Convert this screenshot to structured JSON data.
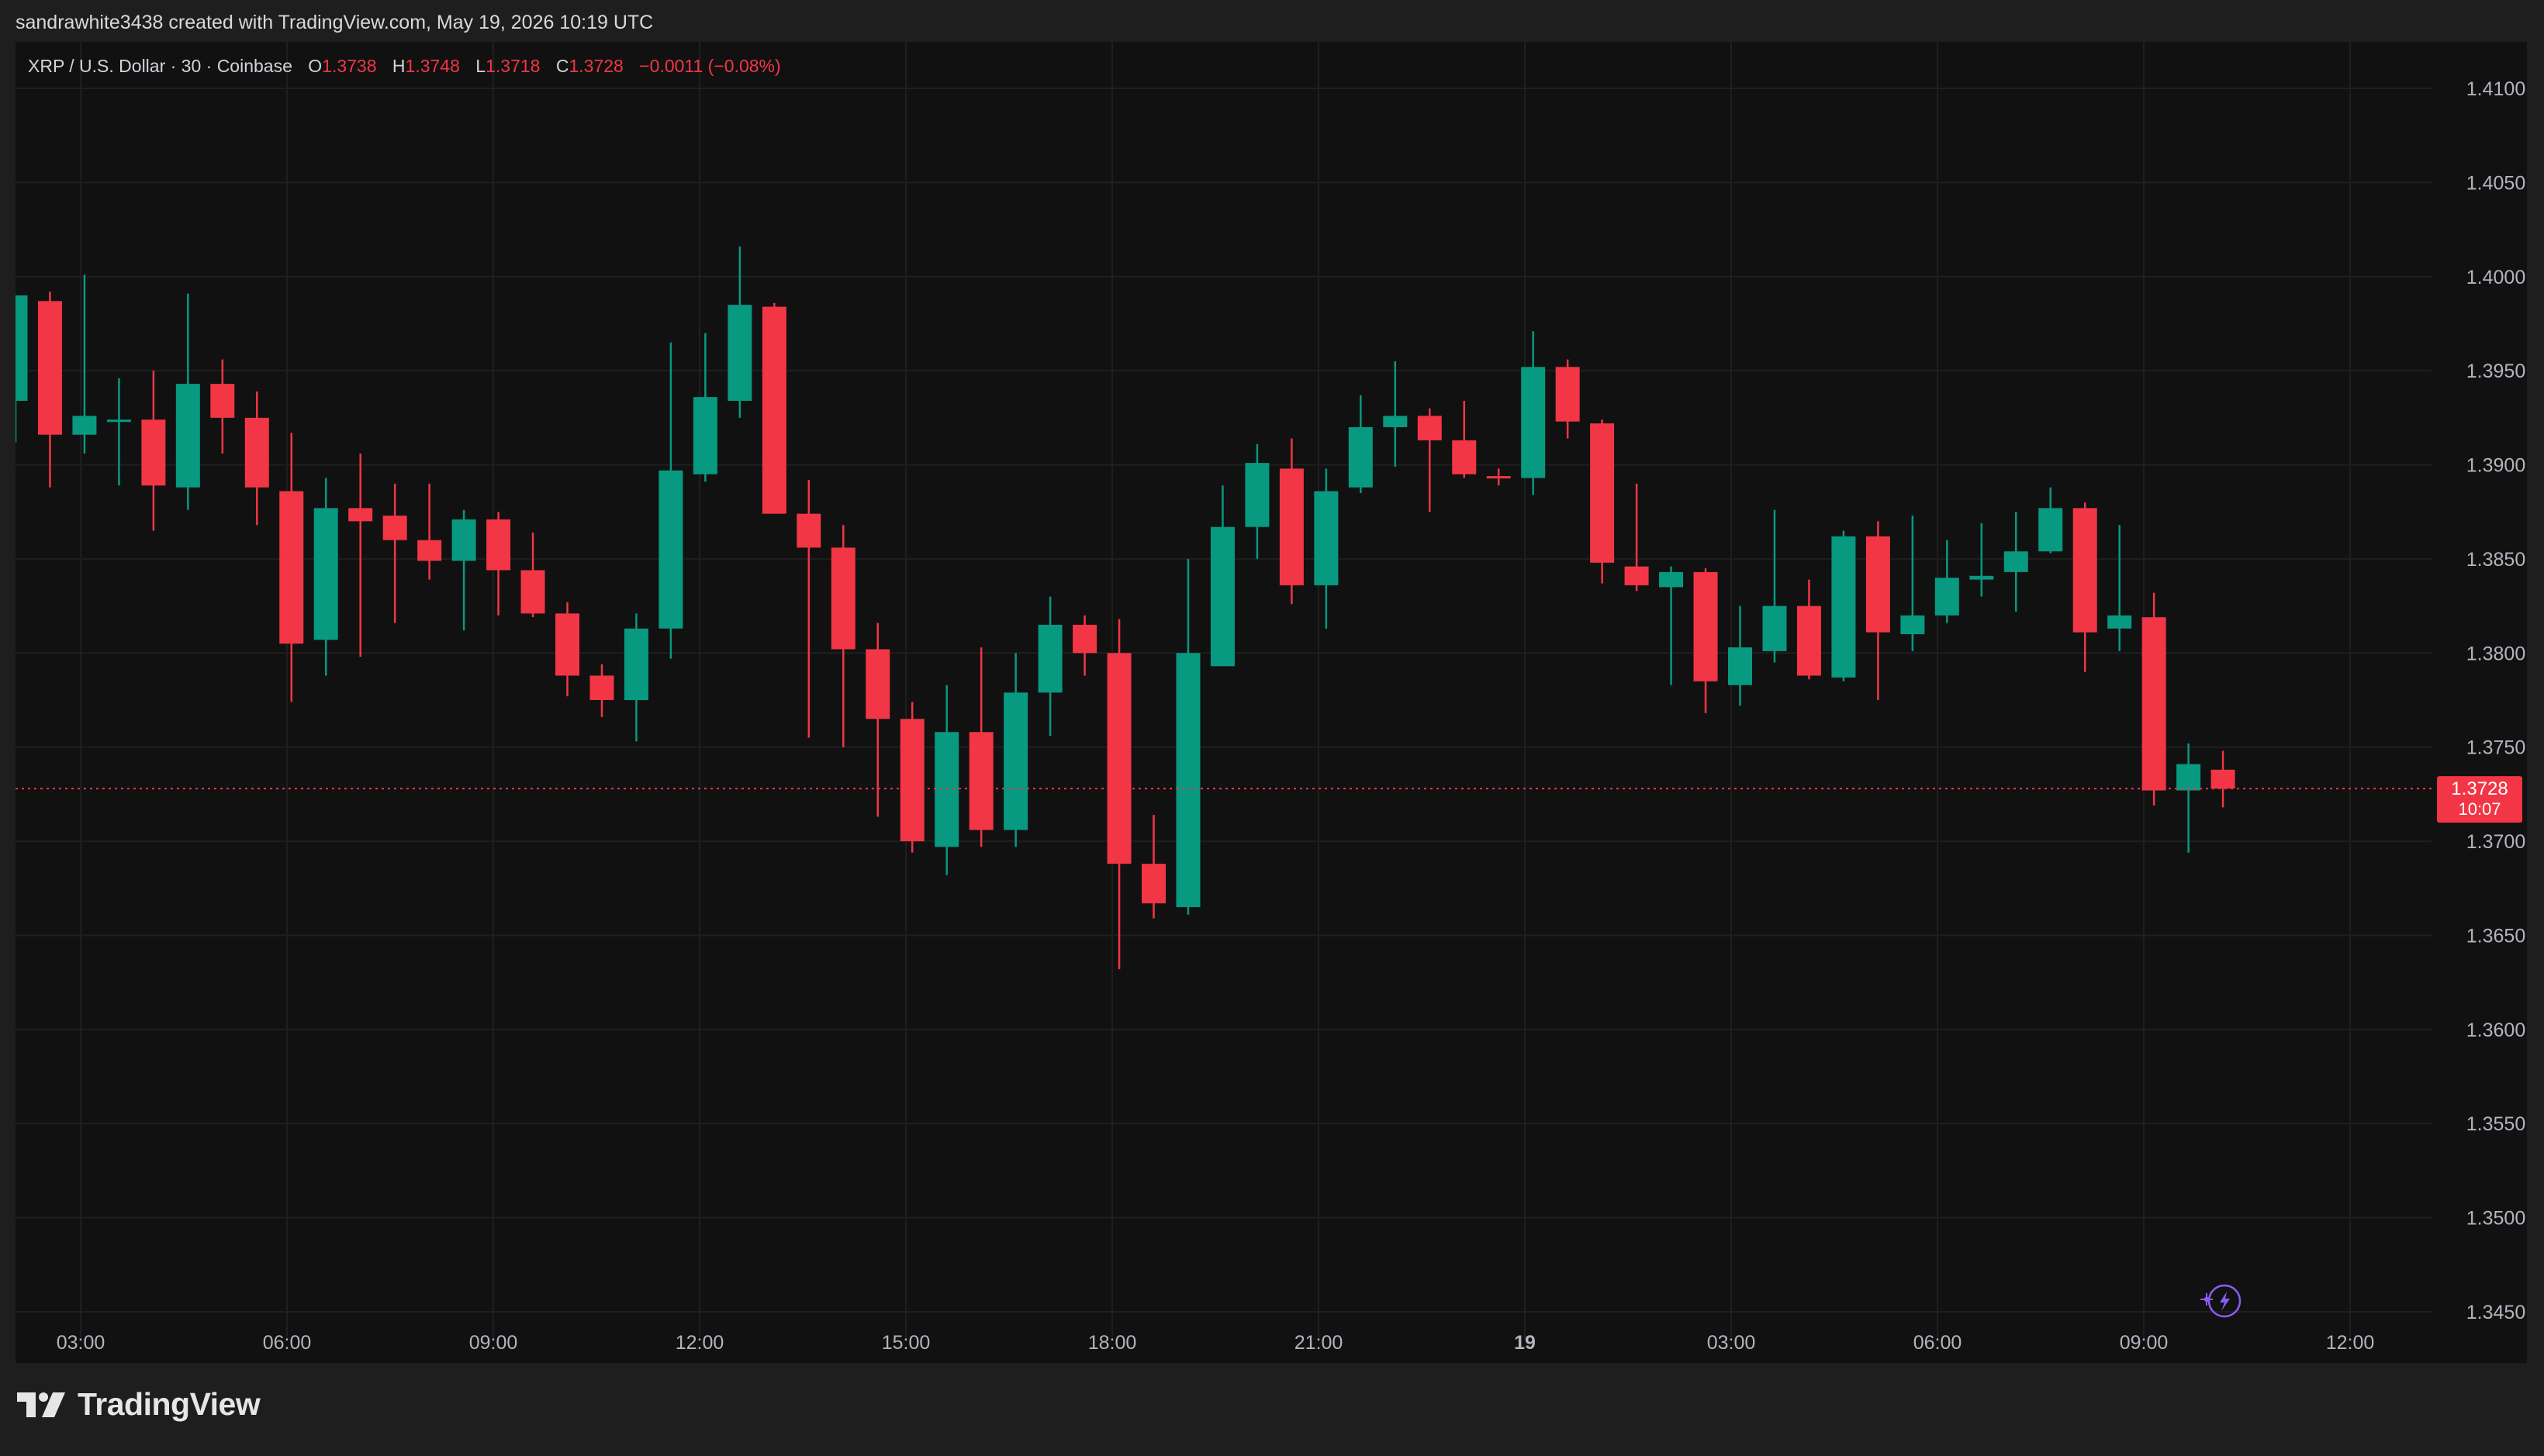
{
  "header": {
    "created_text": "sandrawhite3438 created with TradingView.com, May 19, 2026 10:19 UTC"
  },
  "legend": {
    "symbol_text": "XRP / U.S. Dollar · 30 · Coinbase",
    "open_label": "O",
    "open_value": "1.3738",
    "high_label": "H",
    "high_value": "1.3748",
    "low_label": "L",
    "low_value": "1.3718",
    "close_label": "C",
    "close_value": "1.3728",
    "change_text": "−0.0011 (−0.08%)"
  },
  "price_tag": {
    "price": "1.3728",
    "countdown": "10:07"
  },
  "footer": {
    "brand_name": "TradingView",
    "logo_icon": "tradingview-logo-icon"
  },
  "colors": {
    "up": "#089981",
    "down": "#f23645",
    "background": "#111111",
    "grid": "#1f1f1f",
    "text": "#b2b5be"
  },
  "chart_data": {
    "type": "candlestick",
    "x_ticks": [
      "03:00",
      "06:00",
      "09:00",
      "12:00",
      "15:00",
      "18:00",
      "21:00",
      "19",
      "03:00",
      "06:00",
      "09:00",
      "12:00"
    ],
    "y_ticks": [
      "1.4100",
      "1.4050",
      "1.4000",
      "1.3950",
      "1.3900",
      "1.3850",
      "1.3800",
      "1.3750",
      "1.3700",
      "1.3650",
      "1.3600",
      "1.3550",
      "1.3500",
      "1.3450"
    ],
    "ylim": [
      1.345,
      1.41
    ],
    "interval_minutes": 30,
    "grid": true,
    "current_price": 1.3728,
    "candles": [
      {
        "o": 1.3934,
        "h": 1.399,
        "l": 1.3912,
        "c": 1.399
      },
      {
        "o": 1.3987,
        "h": 1.3992,
        "l": 1.3888,
        "c": 1.3916
      },
      {
        "o": 1.3916,
        "h": 1.4001,
        "l": 1.3906,
        "c": 1.3926
      },
      {
        "o": 1.3924,
        "h": 1.3946,
        "l": 1.3889,
        "c": 1.3924
      },
      {
        "o": 1.3924,
        "h": 1.395,
        "l": 1.3865,
        "c": 1.3889
      },
      {
        "o": 1.3888,
        "h": 1.3991,
        "l": 1.3876,
        "c": 1.3943
      },
      {
        "o": 1.3943,
        "h": 1.3956,
        "l": 1.3906,
        "c": 1.3925
      },
      {
        "o": 1.3925,
        "h": 1.3939,
        "l": 1.3868,
        "c": 1.3888
      },
      {
        "o": 1.3886,
        "h": 1.3917,
        "l": 1.3774,
        "c": 1.3805
      },
      {
        "o": 1.3807,
        "h": 1.3893,
        "l": 1.3788,
        "c": 1.3877
      },
      {
        "o": 1.3877,
        "h": 1.3906,
        "l": 1.3798,
        "c": 1.387
      },
      {
        "o": 1.3873,
        "h": 1.389,
        "l": 1.3816,
        "c": 1.386
      },
      {
        "o": 1.386,
        "h": 1.389,
        "l": 1.3839,
        "c": 1.3849
      },
      {
        "o": 1.3849,
        "h": 1.3876,
        "l": 1.3812,
        "c": 1.3871
      },
      {
        "o": 1.3871,
        "h": 1.3875,
        "l": 1.382,
        "c": 1.3844
      },
      {
        "o": 1.3844,
        "h": 1.3864,
        "l": 1.3819,
        "c": 1.3821
      },
      {
        "o": 1.3821,
        "h": 1.3827,
        "l": 1.3777,
        "c": 1.3788
      },
      {
        "o": 1.3788,
        "h": 1.3794,
        "l": 1.3766,
        "c": 1.3775
      },
      {
        "o": 1.3775,
        "h": 1.3821,
        "l": 1.3753,
        "c": 1.3813
      },
      {
        "o": 1.3813,
        "h": 1.3965,
        "l": 1.3797,
        "c": 1.3897
      },
      {
        "o": 1.3895,
        "h": 1.397,
        "l": 1.3891,
        "c": 1.3936
      },
      {
        "o": 1.3934,
        "h": 1.4016,
        "l": 1.3925,
        "c": 1.3985
      },
      {
        "o": 1.3984,
        "h": 1.3986,
        "l": 1.3874,
        "c": 1.3874
      },
      {
        "o": 1.3874,
        "h": 1.3892,
        "l": 1.3755,
        "c": 1.3856
      },
      {
        "o": 1.3856,
        "h": 1.3868,
        "l": 1.375,
        "c": 1.3802
      },
      {
        "o": 1.3802,
        "h": 1.3816,
        "l": 1.3713,
        "c": 1.3765
      },
      {
        "o": 1.3765,
        "h": 1.3774,
        "l": 1.3694,
        "c": 1.37
      },
      {
        "o": 1.3697,
        "h": 1.3783,
        "l": 1.3682,
        "c": 1.3758
      },
      {
        "o": 1.3758,
        "h": 1.3803,
        "l": 1.3697,
        "c": 1.3706
      },
      {
        "o": 1.3706,
        "h": 1.38,
        "l": 1.3697,
        "c": 1.3779
      },
      {
        "o": 1.3779,
        "h": 1.383,
        "l": 1.3756,
        "c": 1.3815
      },
      {
        "o": 1.3815,
        "h": 1.382,
        "l": 1.3788,
        "c": 1.38
      },
      {
        "o": 1.38,
        "h": 1.3818,
        "l": 1.3632,
        "c": 1.3688
      },
      {
        "o": 1.3688,
        "h": 1.3714,
        "l": 1.3659,
        "c": 1.3667
      },
      {
        "o": 1.3665,
        "h": 1.385,
        "l": 1.3661,
        "c": 1.38
      },
      {
        "o": 1.3793,
        "h": 1.3889,
        "l": 1.3795,
        "c": 1.3867
      },
      {
        "o": 1.3867,
        "h": 1.3911,
        "l": 1.385,
        "c": 1.3901
      },
      {
        "o": 1.3898,
        "h": 1.3914,
        "l": 1.3826,
        "c": 1.3836
      },
      {
        "o": 1.3836,
        "h": 1.3898,
        "l": 1.3813,
        "c": 1.3886
      },
      {
        "o": 1.3888,
        "h": 1.3937,
        "l": 1.3885,
        "c": 1.392
      },
      {
        "o": 1.392,
        "h": 1.3955,
        "l": 1.3899,
        "c": 1.3926
      },
      {
        "o": 1.3926,
        "h": 1.393,
        "l": 1.3875,
        "c": 1.3913
      },
      {
        "o": 1.3913,
        "h": 1.3934,
        "l": 1.3893,
        "c": 1.3895
      },
      {
        "o": 1.3894,
        "h": 1.3898,
        "l": 1.3889,
        "c": 1.3893
      },
      {
        "o": 1.3893,
        "h": 1.3971,
        "l": 1.3884,
        "c": 1.3952
      },
      {
        "o": 1.3952,
        "h": 1.3956,
        "l": 1.3914,
        "c": 1.3923
      },
      {
        "o": 1.3922,
        "h": 1.3924,
        "l": 1.3837,
        "c": 1.3848
      },
      {
        "o": 1.3846,
        "h": 1.389,
        "l": 1.3833,
        "c": 1.3836
      },
      {
        "o": 1.3835,
        "h": 1.3846,
        "l": 1.3783,
        "c": 1.3843
      },
      {
        "o": 1.3843,
        "h": 1.3845,
        "l": 1.3768,
        "c": 1.3785
      },
      {
        "o": 1.3783,
        "h": 1.3825,
        "l": 1.3772,
        "c": 1.3803
      },
      {
        "o": 1.3801,
        "h": 1.3876,
        "l": 1.3795,
        "c": 1.3825
      },
      {
        "o": 1.3825,
        "h": 1.3839,
        "l": 1.3786,
        "c": 1.3788
      },
      {
        "o": 1.3787,
        "h": 1.3865,
        "l": 1.3785,
        "c": 1.3862
      },
      {
        "o": 1.3862,
        "h": 1.387,
        "l": 1.3775,
        "c": 1.3811
      },
      {
        "o": 1.381,
        "h": 1.3873,
        "l": 1.3801,
        "c": 1.382
      },
      {
        "o": 1.382,
        "h": 1.386,
        "l": 1.3816,
        "c": 1.384
      },
      {
        "o": 1.3839,
        "h": 1.3869,
        "l": 1.383,
        "c": 1.3841
      },
      {
        "o": 1.3843,
        "h": 1.3875,
        "l": 1.3822,
        "c": 1.3854
      },
      {
        "o": 1.3854,
        "h": 1.3888,
        "l": 1.3853,
        "c": 1.3877
      },
      {
        "o": 1.3877,
        "h": 1.388,
        "l": 1.379,
        "c": 1.3811
      },
      {
        "o": 1.3813,
        "h": 1.3868,
        "l": 1.3801,
        "c": 1.382
      },
      {
        "o": 1.3819,
        "h": 1.3832,
        "l": 1.3719,
        "c": 1.3727
      },
      {
        "o": 1.3727,
        "h": 1.3752,
        "l": 1.3694,
        "c": 1.3741
      },
      {
        "o": 1.3738,
        "h": 1.3748,
        "l": 1.3718,
        "c": 1.3728
      }
    ]
  }
}
